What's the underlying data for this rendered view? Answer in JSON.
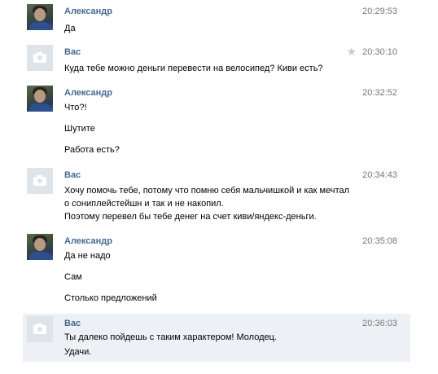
{
  "messages": [
    {
      "author": "Александр",
      "time": "20:29:53",
      "avatar": "user-photo",
      "lines": [
        "Да"
      ]
    },
    {
      "author": "Вас",
      "time": "20:30:10",
      "avatar": "camera-placeholder",
      "starred": true,
      "star_icon": "★",
      "lines": [
        "Куда тебе можно деньги перевести на велосипед? Киви есть?"
      ]
    },
    {
      "author": "Александр",
      "time": "20:32:52",
      "avatar": "user-photo",
      "lines": [
        "Что?!",
        "Шутите",
        "Работа есть?"
      ]
    },
    {
      "author": "Вас",
      "time": "20:34:43",
      "avatar": "camera-placeholder",
      "lines": [
        "Хочу помочь тебе, потому что помню себя мальчишкой и как мечтал",
        "о сониплейстейшн и так и не накопил.",
        "Поэтому перевел бы тебе денег на счет киви/яндекс-деньги."
      ]
    },
    {
      "author": "Александр",
      "time": "20:35:08",
      "avatar": "user-photo",
      "lines": [
        "Да не надо",
        "Сам",
        "Столько предложений"
      ]
    },
    {
      "author": "Вас",
      "time": "20:36:03",
      "avatar": "camera-placeholder",
      "highlighted": true,
      "lines": [
        "Ты далеко пойдешь с таким характером! Молодец.",
        "Удачи."
      ]
    }
  ],
  "colors": {
    "author_name": "#45688e",
    "timestamp": "#777777",
    "highlight_bg": "#edf1f5",
    "star": "#c3cbd4"
  }
}
